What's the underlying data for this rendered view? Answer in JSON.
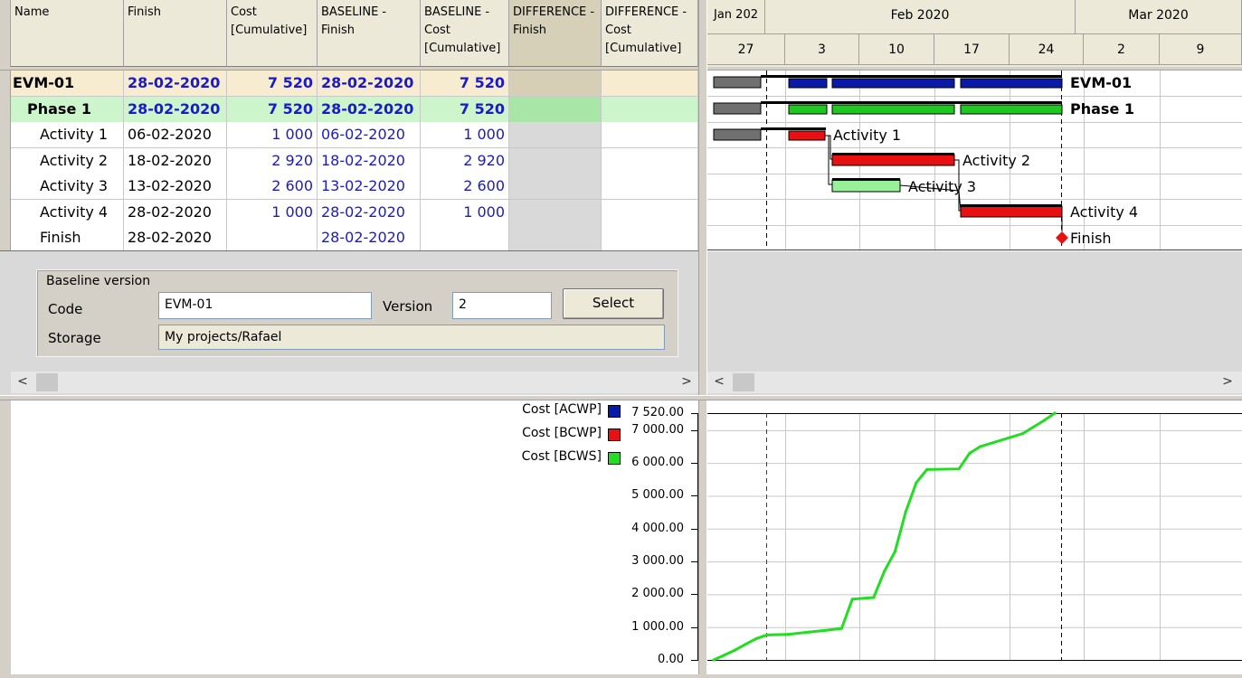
{
  "columns": [
    {
      "label": "Name"
    },
    {
      "label": "Finish"
    },
    {
      "label": "Cost [Cumulative]"
    },
    {
      "label": "BASELINE - Finish"
    },
    {
      "label": "BASELINE - Cost [Cumulative]"
    },
    {
      "label": "DIFFERENCE - Finish"
    },
    {
      "label": "DIFFERENCE - Cost [Cumulative]"
    }
  ],
  "rows": [
    {
      "name": "EVM-01",
      "finish": "28-02-2020",
      "cost": "7 520",
      "bfinish": "28-02-2020",
      "bcost": "7 520"
    },
    {
      "name": "Phase 1",
      "finish": "28-02-2020",
      "cost": "7 520",
      "bfinish": "28-02-2020",
      "bcost": "7 520"
    },
    {
      "name": "Activity 1",
      "finish": "06-02-2020",
      "cost": "1 000",
      "bfinish": "06-02-2020",
      "bcost": "1 000"
    },
    {
      "name": "Activity 2",
      "finish": "18-02-2020",
      "cost": "2 920",
      "bfinish": "18-02-2020",
      "bcost": "2 920"
    },
    {
      "name": "Activity 3",
      "finish": "13-02-2020",
      "cost": "2 600",
      "bfinish": "13-02-2020",
      "bcost": "2 600"
    },
    {
      "name": "Activity 4",
      "finish": "28-02-2020",
      "cost": "1 000",
      "bfinish": "28-02-2020",
      "bcost": "1 000"
    },
    {
      "name": "Finish",
      "finish": "28-02-2020",
      "cost": "",
      "bfinish": "28-02-2020",
      "bcost": ""
    }
  ],
  "baseline": {
    "group_label": "Baseline version",
    "code_label": "Code",
    "code_value": "EVM-01",
    "version_label": "Version",
    "version_value": "2",
    "select_label": "Select",
    "storage_label": "Storage",
    "storage_value": "My projects/Rafael"
  },
  "timeline": {
    "months": [
      "Jan 202",
      "Feb 2020",
      "Mar 2020"
    ],
    "weeks": [
      "27",
      "3",
      "10",
      "17",
      "24",
      "2",
      "9"
    ]
  },
  "gantt_labels": [
    "EVM-01",
    "Phase 1",
    "Activity 1",
    "Activity 2",
    "Activity 3",
    "Activity 4",
    "Finish"
  ],
  "chart_data": {
    "type": "line",
    "legend": [
      {
        "name": "Cost [ACWP]",
        "color": "#0a1aa8"
      },
      {
        "name": "Cost [BCWP]",
        "color": "#e81010"
      },
      {
        "name": "Cost [BCWS]",
        "color": "#22dd22"
      }
    ],
    "y_ticks": [
      "7 520.00",
      "7 000.00",
      "6 000.00",
      "5 000.00",
      "4 000.00",
      "3 000.00",
      "2 000.00",
      "1 000.00",
      "0.00"
    ],
    "y_tick_values": [
      7520,
      7000,
      6000,
      5000,
      4000,
      3000,
      2000,
      1000,
      0
    ],
    "ylim": [
      0,
      7520
    ],
    "xlim_days": [
      "2020-01-26",
      "2020-03-13"
    ],
    "series": [
      {
        "name": "Cost [BCWS]",
        "color": "#22dd22",
        "points": [
          [
            "2020-01-27",
            0
          ],
          [
            "2020-01-28",
            150
          ],
          [
            "2020-01-29",
            300
          ],
          [
            "2020-01-30",
            480
          ],
          [
            "2020-01-31",
            650
          ],
          [
            "2020-02-01",
            760
          ],
          [
            "2020-02-03",
            780
          ],
          [
            "2020-02-05",
            850
          ],
          [
            "2020-02-07",
            920
          ],
          [
            "2020-02-08",
            960
          ],
          [
            "2020-02-09",
            1850
          ],
          [
            "2020-02-11",
            1900
          ],
          [
            "2020-02-12",
            2700
          ],
          [
            "2020-02-13",
            3300
          ],
          [
            "2020-02-14",
            4500
          ],
          [
            "2020-02-15",
            5400
          ],
          [
            "2020-02-16",
            5800
          ],
          [
            "2020-02-19",
            5820
          ],
          [
            "2020-02-20",
            6300
          ],
          [
            "2020-02-21",
            6500
          ],
          [
            "2020-02-23",
            6700
          ],
          [
            "2020-02-25",
            6900
          ],
          [
            "2020-02-27",
            7300
          ],
          [
            "2020-02-28",
            7520
          ]
        ]
      }
    ],
    "grid": true
  }
}
